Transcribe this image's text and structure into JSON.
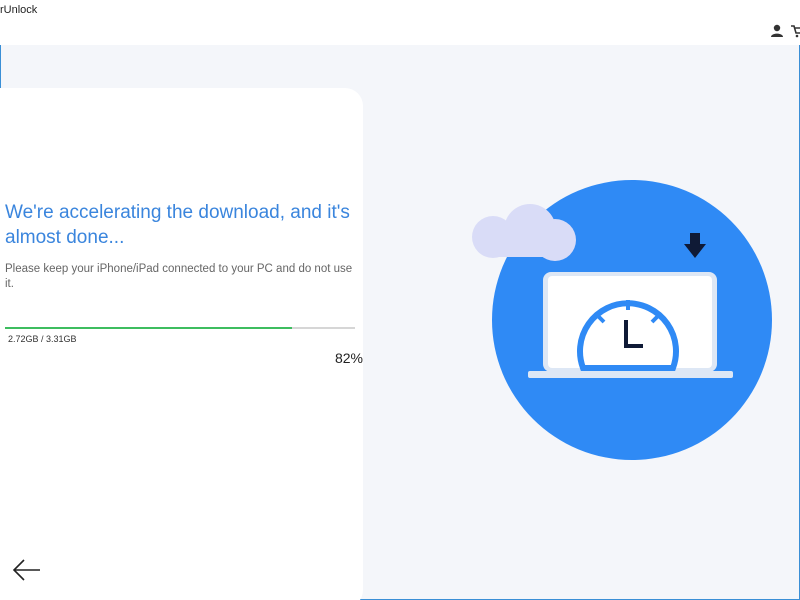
{
  "window": {
    "title": "rUnlock"
  },
  "header": {
    "user_icon": "user-icon",
    "cart_icon": "cart-icon"
  },
  "download": {
    "headline": "We're accelerating the download, and it's almost done...",
    "instruction": "Please keep your iPhone/iPad connected to your PC and do not use it.",
    "size_text": "2.72GB  /  3.31GB",
    "percent_text": "82%",
    "progress": 0.82
  },
  "nav": {
    "back_icon": "arrow-left-icon"
  },
  "illustration": {
    "icons": [
      "cloud-icon",
      "download-arrow-icon",
      "laptop-icon",
      "clock-icon"
    ]
  },
  "colors": {
    "accent": "#3a85dd",
    "circle": "#2f8af5",
    "progress": "#3dbd5f",
    "cloud": "#d9dcf7"
  }
}
